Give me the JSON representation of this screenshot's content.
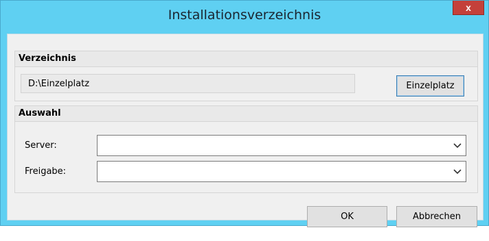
{
  "window": {
    "title": "Installationsverzeichnis",
    "close_label": "x"
  },
  "verzeichnis": {
    "heading": "Verzeichnis",
    "path_value": "D:\\Einzelplatz",
    "button_label": "Einzelplatz"
  },
  "auswahl": {
    "heading": "Auswahl",
    "server_label": "Server:",
    "server_value": "",
    "freigabe_label": "Freigabe:",
    "freigabe_value": ""
  },
  "footer": {
    "ok_label": "OK",
    "cancel_label": "Abbrechen"
  },
  "colors": {
    "titlebar": "#5fd0f2",
    "close_button": "#c4403a",
    "dialog_background": "#f0f0f0"
  }
}
